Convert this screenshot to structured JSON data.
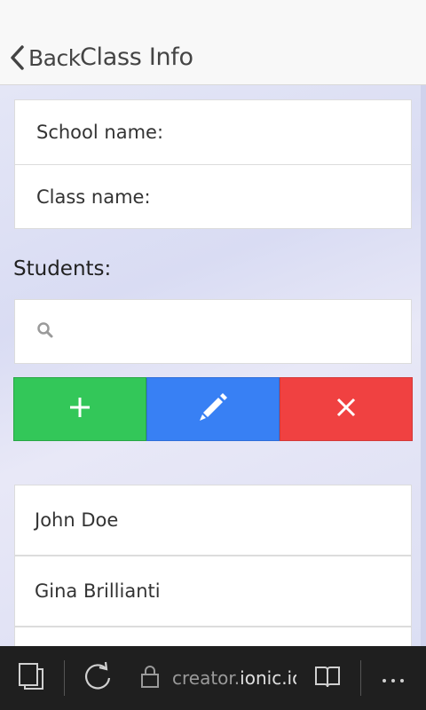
{
  "header": {
    "back_label": "Back",
    "title": "Class Info"
  },
  "form": {
    "school_label": "School name:",
    "class_label": "Class name:"
  },
  "students": {
    "label": "Students:",
    "search_placeholder": ""
  },
  "actions": {
    "add_icon": "plus-icon",
    "edit_icon": "pencil-icon",
    "delete_icon": "close-icon",
    "colors": {
      "add": "#33c759",
      "edit": "#3880f4",
      "delete": "#f04141"
    }
  },
  "student_list": [
    {
      "name": "John Doe"
    },
    {
      "name": "Gina Brillianti"
    }
  ],
  "browser": {
    "url_prefix": "creator.",
    "url_domain": "ionic.io"
  }
}
